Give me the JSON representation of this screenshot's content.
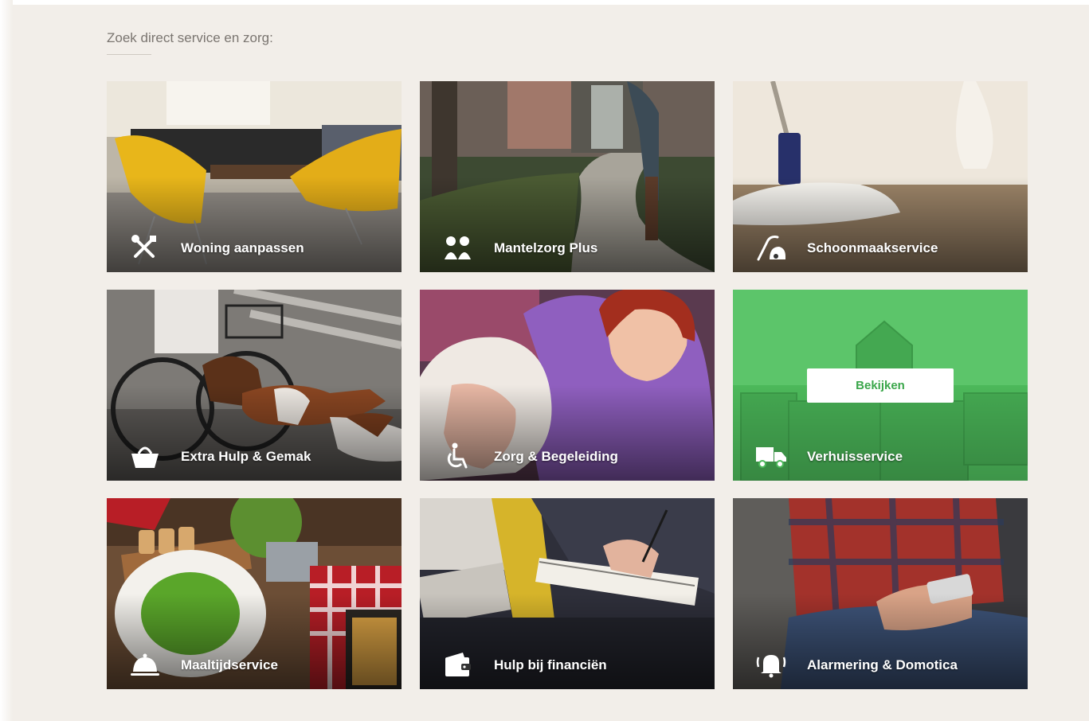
{
  "section": {
    "heading": "Zoek direct service en zorg:"
  },
  "tiles": [
    {
      "label": "Woning aanpassen",
      "icon": "tools-icon"
    },
    {
      "label": "Mantelzorg Plus",
      "icon": "two-people-icon"
    },
    {
      "label": "Schoonmaakservice",
      "icon": "vacuum-icon"
    },
    {
      "label": "Extra Hulp & Gemak",
      "icon": "shopping-basket-icon"
    },
    {
      "label": "Zorg & Begeleiding",
      "icon": "wheelchair-icon"
    },
    {
      "label": "Verhuisservice",
      "icon": "moving-truck-icon",
      "button": "Bekijken"
    },
    {
      "label": "Maaltijdservice",
      "icon": "food-cloche-icon"
    },
    {
      "label": "Hulp bij financiën",
      "icon": "wallet-icon"
    },
    {
      "label": "Alarmering & Domotica",
      "icon": "alarm-bell-icon"
    }
  ],
  "colors": {
    "page_background": "#f2eee9",
    "highlight_green": "#4cb85a",
    "button_text": "#3aa64a"
  }
}
